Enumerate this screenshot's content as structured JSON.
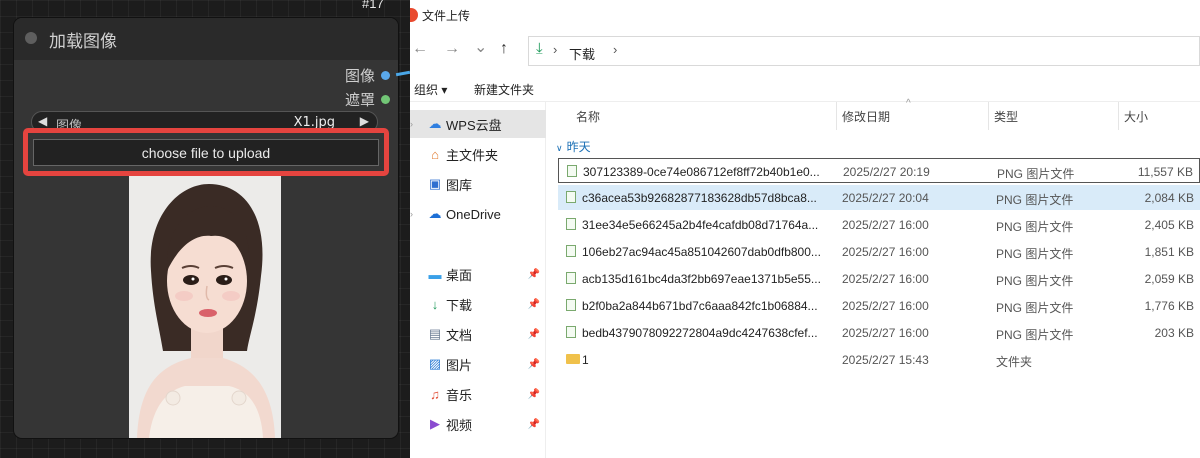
{
  "node": {
    "id": "#17",
    "title": "加载图像",
    "outputs": [
      {
        "label": "图像",
        "color": "#5aa8ea"
      },
      {
        "label": "遮罩",
        "color": "#72c676"
      }
    ],
    "combo": {
      "left_arrow": "◀",
      "label": "图像",
      "value": "X1.jpg",
      "right_arrow": "▶"
    },
    "upload_button": "choose file to upload",
    "highlight_color": "#e5443f"
  },
  "dialog": {
    "title": "文件上传",
    "nav_icons": {
      "back": "←",
      "forward": "→",
      "history": "⌄",
      "up": "↑"
    },
    "address": {
      "sep": "›",
      "crumb": "下载"
    },
    "toolbar": {
      "organize": "组织 ▾",
      "new_folder": "新建文件夹"
    },
    "sidebar": [
      {
        "label": "WPS云盘",
        "icon": "cloud-icon",
        "glyph": "☁",
        "expand": "›",
        "pinned": false,
        "selected": true
      },
      {
        "label": "主文件夹",
        "icon": "home-icon",
        "glyph": "⌂",
        "expand": "",
        "pinned": false,
        "selected": false
      },
      {
        "label": "图库",
        "icon": "gallery-icon",
        "glyph": "▣",
        "expand": "",
        "pinned": false,
        "selected": false
      },
      {
        "label": "OneDrive",
        "icon": "onedrive-icon",
        "glyph": "☁",
        "expand": "›",
        "pinned": false,
        "selected": false
      },
      {
        "label": "桌面",
        "icon": "desktop-icon",
        "glyph": "▬",
        "expand": "",
        "pinned": true,
        "selected": false
      },
      {
        "label": "下载",
        "icon": "download-icon",
        "glyph": "↓",
        "expand": "",
        "pinned": true,
        "selected": false
      },
      {
        "label": "文档",
        "icon": "document-icon",
        "glyph": "▤",
        "expand": "",
        "pinned": true,
        "selected": false
      },
      {
        "label": "图片",
        "icon": "pictures-icon",
        "glyph": "▨",
        "expand": "",
        "pinned": true,
        "selected": false
      },
      {
        "label": "音乐",
        "icon": "music-icon",
        "glyph": "♫",
        "expand": "",
        "pinned": true,
        "selected": false
      },
      {
        "label": "视频",
        "icon": "video-icon",
        "glyph": "▶",
        "expand": "",
        "pinned": true,
        "selected": false
      }
    ],
    "pin_glyph": "📌",
    "columns": {
      "name": "名称",
      "date": "修改日期",
      "type": "类型",
      "size": "大小",
      "sort_caret": "^"
    },
    "group": {
      "label": "昨天",
      "chevron": "∨"
    },
    "files": [
      {
        "name": "307123389-0ce74e086712ef8ff72b40b1e0...",
        "date": "2025/2/27 20:19",
        "type": "PNG 图片文件",
        "size": "11,557 KB",
        "kind": "png",
        "state": "focus"
      },
      {
        "name": "c36acea53b92682877183628db57d8bca8...",
        "date": "2025/2/27 20:04",
        "type": "PNG 图片文件",
        "size": "2,084 KB",
        "kind": "png",
        "state": "selected"
      },
      {
        "name": "31ee34e5e66245a2b4fe4cafdb08d71764a...",
        "date": "2025/2/27 16:00",
        "type": "PNG 图片文件",
        "size": "2,405 KB",
        "kind": "png",
        "state": ""
      },
      {
        "name": "106eb27ac94ac45a851042607dab0dfb800...",
        "date": "2025/2/27 16:00",
        "type": "PNG 图片文件",
        "size": "1,851 KB",
        "kind": "png",
        "state": ""
      },
      {
        "name": "acb135d161bc4da3f2bb697eae1371b5e55...",
        "date": "2025/2/27 16:00",
        "type": "PNG 图片文件",
        "size": "2,059 KB",
        "kind": "png",
        "state": ""
      },
      {
        "name": "b2f0ba2a844b671bd7c6aaa842fc1b06884...",
        "date": "2025/2/27 16:00",
        "type": "PNG 图片文件",
        "size": "1,776 KB",
        "kind": "png",
        "state": ""
      },
      {
        "name": "bedb4379078092272804a9dc4247638cfef...",
        "date": "2025/2/27 16:00",
        "type": "PNG 图片文件",
        "size": "203 KB",
        "kind": "png",
        "state": ""
      },
      {
        "name": "1",
        "date": "2025/2/27 15:43",
        "type": "文件夹",
        "size": "",
        "kind": "folder",
        "state": ""
      }
    ]
  }
}
